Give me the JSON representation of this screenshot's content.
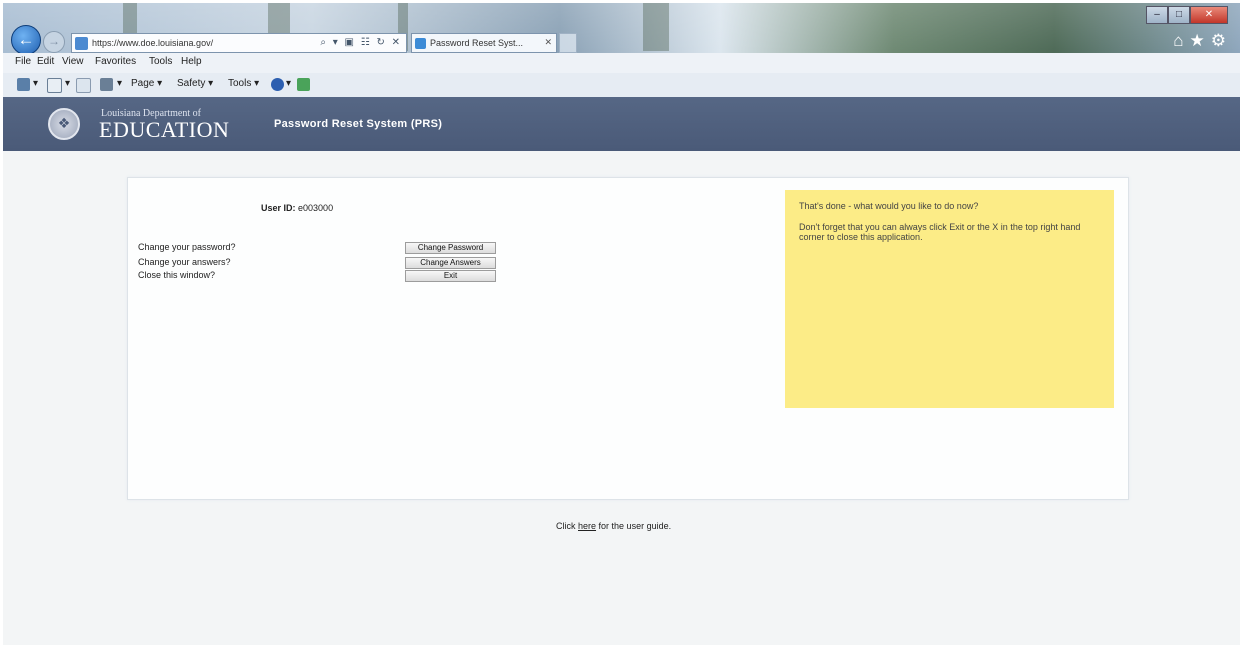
{
  "browser": {
    "address_url": "https://www.doe.louisiana.gov/",
    "address_host": "louisiana.gov",
    "tab_title": "Password Reset Syst...",
    "menu": [
      "File",
      "Edit",
      "View",
      "Favorites",
      "Tools",
      "Help"
    ],
    "command_bar": {
      "page": "Page",
      "safety": "Safety",
      "tools": "Tools"
    },
    "address_controls": "⌕ ▾ ▣ ☷ ↻ ✕"
  },
  "header": {
    "dept_name": "Louisiana Department of",
    "logo_word": "EDUCATION",
    "system_title": "Password Reset System (PRS)"
  },
  "main": {
    "user_id_label": "User ID:",
    "user_id_value": "e003000",
    "actions": [
      {
        "question": "Change your password?",
        "button": "Change Password"
      },
      {
        "question": "Change your answers?",
        "button": "Change Answers"
      },
      {
        "question": "Close this window?",
        "button": "Exit"
      }
    ]
  },
  "note": {
    "heading": "That's done - what would you like to do now?",
    "body": "Don't forget that you can always click Exit or the X in the top right hand corner to close this application."
  },
  "footer": {
    "guide_prefix": "Click",
    "guide_link": "here",
    "guide_suffix": "for the user guide."
  },
  "colors": {
    "header_bg": "#4f5f7e",
    "note_bg": "#fcec87",
    "page_bg": "#f3f5f6"
  },
  "icons": [
    "back-arrow-icon",
    "forward-arrow-icon",
    "home-icon",
    "favorites-star-icon",
    "tools-gear-icon",
    "help-icon",
    "print-icon",
    "feeds-icon",
    "mail-icon",
    "seal-icon"
  ]
}
